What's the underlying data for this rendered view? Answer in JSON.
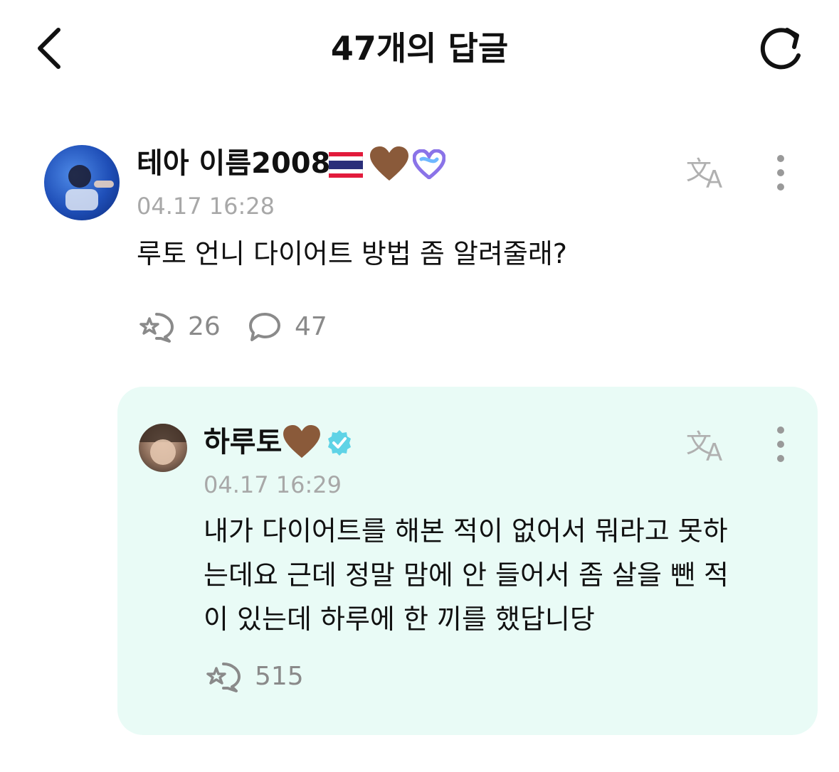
{
  "header": {
    "title": "47개의 답글",
    "back_icon": "chevron-left-icon",
    "refresh_icon": "refresh-icon"
  },
  "comment": {
    "username": "테아 이름2008",
    "emoji": [
      "🇹🇭",
      "🤎",
      "💙"
    ],
    "timestamp": "04.17 16:28",
    "text": "루토 언니 다이어트 방법 좀 알려줄래?",
    "likes": "26",
    "replies": "47"
  },
  "reply": {
    "username": "하루토",
    "emoji": [
      "🤎"
    ],
    "timestamp": "04.17 16:29",
    "lines": [
      "내가 다이어트를 해본 적이 없어서 뭐라고 못하",
      "는데요 근데 정말 맘에 안 들어서 좀 살을 뺀 적",
      "이 있는데 하루에 한 끼를 했답니당"
    ],
    "likes": "515"
  },
  "colors": {
    "reply_bg": "#e9fbf6",
    "muted": "#a8a8a8",
    "verified": "#5fd3e6"
  }
}
